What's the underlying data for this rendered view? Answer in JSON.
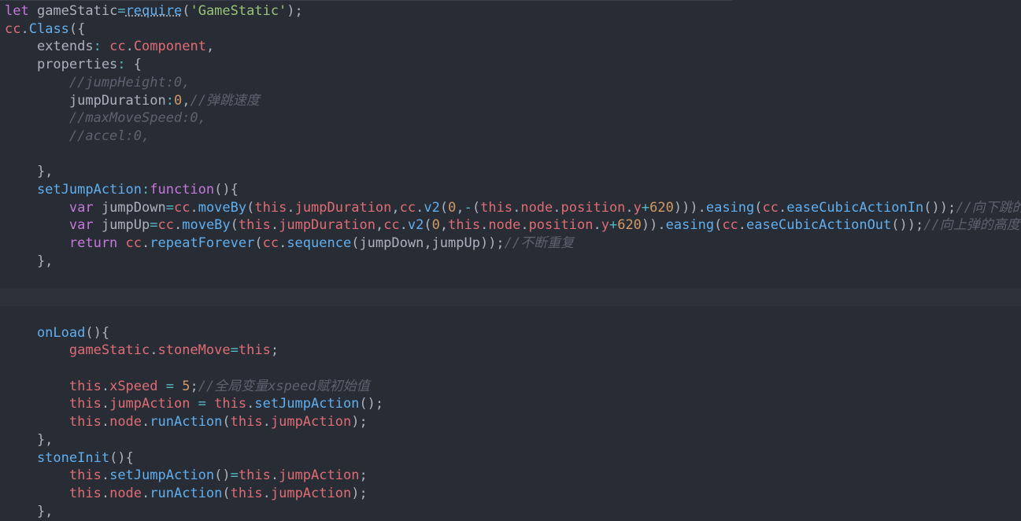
{
  "editor": {
    "lines": [
      [
        [
          "k",
          "let"
        ],
        [
          "v",
          " gameStatic"
        ],
        [
          "o",
          "="
        ],
        [
          "f",
          "require"
        ],
        [
          "p",
          "("
        ],
        [
          "s",
          "'GameStatic'"
        ],
        [
          "p",
          ");"
        ]
      ],
      [
        [
          "t",
          "cc"
        ],
        [
          "p",
          "."
        ],
        [
          "f",
          "Class"
        ],
        [
          "p",
          "({"
        ]
      ],
      [
        [
          "v",
          "    extends"
        ],
        [
          "o",
          ":"
        ],
        [
          "t",
          " cc"
        ],
        [
          "p",
          "."
        ],
        [
          "cls",
          "Component"
        ],
        [
          "p",
          ","
        ]
      ],
      [
        [
          "v",
          "    properties"
        ],
        [
          "o",
          ":"
        ],
        [
          "p",
          " {"
        ]
      ],
      [
        [
          "c",
          "        //jumpHeight:0,"
        ]
      ],
      [
        [
          "v",
          "        jumpDuration"
        ],
        [
          "o",
          ":"
        ],
        [
          "n",
          "0"
        ],
        [
          "p",
          ","
        ],
        [
          "c",
          "//弹跳速度"
        ]
      ],
      [
        [
          "c",
          "        //maxMoveSpeed:0,"
        ]
      ],
      [
        [
          "c",
          "        //accel:0,"
        ]
      ],
      [
        [
          "p",
          ""
        ]
      ],
      [
        [
          "p",
          "    },"
        ]
      ],
      [
        [
          "f",
          "    setJumpAction"
        ],
        [
          "o",
          ":"
        ],
        [
          "k",
          "function"
        ],
        [
          "p",
          "(){"
        ]
      ],
      [
        [
          "k",
          "        var"
        ],
        [
          "v",
          " jumpDown"
        ],
        [
          "o",
          "="
        ],
        [
          "t",
          "cc"
        ],
        [
          "p",
          "."
        ],
        [
          "f",
          "moveBy"
        ],
        [
          "p",
          "("
        ],
        [
          "t",
          "this"
        ],
        [
          "p",
          "."
        ],
        [
          "t",
          "jumpDuration"
        ],
        [
          "p",
          ","
        ],
        [
          "t",
          "cc"
        ],
        [
          "p",
          "."
        ],
        [
          "f",
          "v2"
        ],
        [
          "p",
          "("
        ],
        [
          "n",
          "0"
        ],
        [
          "p",
          ","
        ],
        [
          "o",
          "-"
        ],
        [
          "p",
          "("
        ],
        [
          "t",
          "this"
        ],
        [
          "p",
          "."
        ],
        [
          "t",
          "node"
        ],
        [
          "p",
          "."
        ],
        [
          "t",
          "position"
        ],
        [
          "p",
          "."
        ],
        [
          "t",
          "y"
        ],
        [
          "o",
          "+"
        ],
        [
          "n",
          "620"
        ],
        [
          "p",
          ")))."
        ],
        [
          "f",
          "easing"
        ],
        [
          "p",
          "("
        ],
        [
          "t",
          "cc"
        ],
        [
          "p",
          "."
        ],
        [
          "f",
          "easeCubicActionIn"
        ],
        [
          "p",
          "());"
        ],
        [
          "c",
          "//向下跳的高度"
        ]
      ],
      [
        [
          "k",
          "        var"
        ],
        [
          "v",
          " jumpUp"
        ],
        [
          "o",
          "="
        ],
        [
          "t",
          "cc"
        ],
        [
          "p",
          "."
        ],
        [
          "f",
          "moveBy"
        ],
        [
          "p",
          "("
        ],
        [
          "t",
          "this"
        ],
        [
          "p",
          "."
        ],
        [
          "t",
          "jumpDuration"
        ],
        [
          "p",
          ","
        ],
        [
          "t",
          "cc"
        ],
        [
          "p",
          "."
        ],
        [
          "f",
          "v2"
        ],
        [
          "p",
          "("
        ],
        [
          "n",
          "0"
        ],
        [
          "p",
          ","
        ],
        [
          "t",
          "this"
        ],
        [
          "p",
          "."
        ],
        [
          "t",
          "node"
        ],
        [
          "p",
          "."
        ],
        [
          "t",
          "position"
        ],
        [
          "p",
          "."
        ],
        [
          "t",
          "y"
        ],
        [
          "o",
          "+"
        ],
        [
          "n",
          "620"
        ],
        [
          "p",
          "))."
        ],
        [
          "f",
          "easing"
        ],
        [
          "p",
          "("
        ],
        [
          "t",
          "cc"
        ],
        [
          "p",
          "."
        ],
        [
          "f",
          "easeCubicActionOut"
        ],
        [
          "p",
          "());"
        ],
        [
          "c",
          "//向上弹的高度"
        ]
      ],
      [
        [
          "k",
          "        return"
        ],
        [
          "t",
          " cc"
        ],
        [
          "p",
          "."
        ],
        [
          "f",
          "repeatForever"
        ],
        [
          "p",
          "("
        ],
        [
          "t",
          "cc"
        ],
        [
          "p",
          "."
        ],
        [
          "f",
          "sequence"
        ],
        [
          "p",
          "(jumpDown,jumpUp));"
        ],
        [
          "c",
          "//不断重复"
        ]
      ],
      [
        [
          "p",
          "    },"
        ]
      ],
      [
        [
          "p",
          ""
        ]
      ],
      [
        [
          "p",
          ""
        ]
      ],
      [
        [
          "p",
          ""
        ]
      ],
      [
        [
          "f",
          "    onLoad"
        ],
        [
          "p",
          "(){"
        ]
      ],
      [
        [
          "t",
          "        gameStatic"
        ],
        [
          "p",
          "."
        ],
        [
          "t",
          "stoneMove"
        ],
        [
          "o",
          "="
        ],
        [
          "t",
          "this"
        ],
        [
          "p",
          ";"
        ]
      ],
      [
        [
          "p",
          ""
        ]
      ],
      [
        [
          "t",
          "        this"
        ],
        [
          "p",
          "."
        ],
        [
          "t",
          "xSpeed"
        ],
        [
          "o",
          " = "
        ],
        [
          "n",
          "5"
        ],
        [
          "p",
          ";"
        ],
        [
          "c",
          "//全局变量xspeed赋初始值"
        ]
      ],
      [
        [
          "t",
          "        this"
        ],
        [
          "p",
          "."
        ],
        [
          "t",
          "jumpAction"
        ],
        [
          "o",
          " = "
        ],
        [
          "t",
          "this"
        ],
        [
          "p",
          "."
        ],
        [
          "f",
          "setJumpAction"
        ],
        [
          "p",
          "();"
        ]
      ],
      [
        [
          "t",
          "        this"
        ],
        [
          "p",
          "."
        ],
        [
          "t",
          "node"
        ],
        [
          "p",
          "."
        ],
        [
          "f",
          "runAction"
        ],
        [
          "p",
          "("
        ],
        [
          "t",
          "this"
        ],
        [
          "p",
          "."
        ],
        [
          "t",
          "jumpAction"
        ],
        [
          "p",
          ");"
        ]
      ],
      [
        [
          "p",
          "    },"
        ]
      ],
      [
        [
          "f",
          "    stoneInit"
        ],
        [
          "p",
          "(){"
        ]
      ],
      [
        [
          "t",
          "        this"
        ],
        [
          "p",
          "."
        ],
        [
          "f",
          "setJumpAction"
        ],
        [
          "p",
          "()"
        ],
        [
          "o",
          "="
        ],
        [
          "t",
          "this"
        ],
        [
          "p",
          "."
        ],
        [
          "t",
          "jumpAction"
        ],
        [
          "p",
          ";"
        ]
      ],
      [
        [
          "t",
          "        this"
        ],
        [
          "p",
          "."
        ],
        [
          "t",
          "node"
        ],
        [
          "p",
          "."
        ],
        [
          "f",
          "runAction"
        ],
        [
          "p",
          "("
        ],
        [
          "t",
          "this"
        ],
        [
          "p",
          "."
        ],
        [
          "t",
          "jumpAction"
        ],
        [
          "p",
          ");"
        ]
      ],
      [
        [
          "p",
          "    },"
        ]
      ]
    ],
    "active_line": 16,
    "theme_colors": {
      "background": "#282c34",
      "keyword": "#c678dd",
      "variable": "#e06c75",
      "function": "#61afef",
      "string": "#98c379",
      "number": "#d19a66",
      "operator": "#56b6c2",
      "comment": "#5c6370"
    }
  }
}
